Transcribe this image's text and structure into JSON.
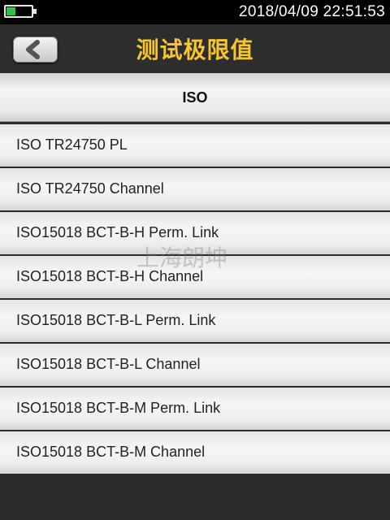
{
  "status_bar": {
    "datetime": "2018/04/09  22:51:53",
    "battery_level": 0.35,
    "battery_color": "#2ec24a"
  },
  "header": {
    "title": "测试极限值",
    "back_icon": "chevron-left-icon",
    "title_color": "#f6c530"
  },
  "section": {
    "label": "ISO"
  },
  "list": {
    "items": [
      {
        "label": "ISO TR24750 PL"
      },
      {
        "label": "ISO TR24750 Channel"
      },
      {
        "label": "ISO15018 BCT-B-H Perm. Link"
      },
      {
        "label": "ISO15018 BCT-B-H Channel"
      },
      {
        "label": "ISO15018 BCT-B-L Perm. Link"
      },
      {
        "label": "ISO15018 BCT-B-L Channel"
      },
      {
        "label": "ISO15018 BCT-B-M Perm. Link"
      },
      {
        "label": "ISO15018 BCT-B-M Channel"
      }
    ]
  },
  "watermark": "上海朗坤"
}
